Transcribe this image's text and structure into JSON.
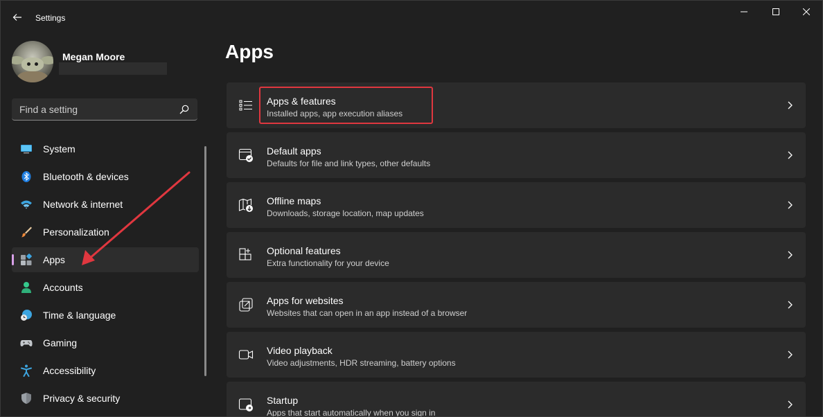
{
  "window": {
    "title": "Settings",
    "controls": {
      "minimize": "minimize-icon",
      "maximize": "maximize-icon",
      "close": "close-icon"
    }
  },
  "profile": {
    "name": "Megan Moore"
  },
  "search": {
    "placeholder": "Find a setting",
    "value": ""
  },
  "sidebar": {
    "items": [
      {
        "label": "System",
        "icon": "system-monitor-icon"
      },
      {
        "label": "Bluetooth & devices",
        "icon": "bluetooth-icon"
      },
      {
        "label": "Network & internet",
        "icon": "wifi-icon"
      },
      {
        "label": "Personalization",
        "icon": "brush-icon"
      },
      {
        "label": "Apps",
        "icon": "apps-icon",
        "selected": true
      },
      {
        "label": "Accounts",
        "icon": "person-icon"
      },
      {
        "label": "Time & language",
        "icon": "clock-globe-icon"
      },
      {
        "label": "Gaming",
        "icon": "gamepad-icon"
      },
      {
        "label": "Accessibility",
        "icon": "accessibility-icon"
      },
      {
        "label": "Privacy & security",
        "icon": "shield-icon"
      }
    ]
  },
  "main": {
    "title": "Apps",
    "cards": [
      {
        "title": "Apps & features",
        "subtitle": "Installed apps, app execution aliases",
        "icon": "list-icon",
        "highlighted": true
      },
      {
        "title": "Default apps",
        "subtitle": "Defaults for file and link types, other defaults",
        "icon": "default-apps-icon"
      },
      {
        "title": "Offline maps",
        "subtitle": "Downloads, storage location, map updates",
        "icon": "map-download-icon"
      },
      {
        "title": "Optional features",
        "subtitle": "Extra functionality for your device",
        "icon": "add-grid-icon"
      },
      {
        "title": "Apps for websites",
        "subtitle": "Websites that can open in an app instead of a browser",
        "icon": "open-link-icon"
      },
      {
        "title": "Video playback",
        "subtitle": "Video adjustments, HDR streaming, battery options",
        "icon": "video-camera-icon"
      },
      {
        "title": "Startup",
        "subtitle": "Apps that start automatically when you sign in",
        "icon": "startup-icon"
      }
    ]
  },
  "colors": {
    "background": "#202020",
    "sidebar_selected": "#2d2d2d",
    "card_background": "#2b2b2b",
    "accent_indicator": "#d8a0e8",
    "annotation_red": "#e0373f"
  }
}
